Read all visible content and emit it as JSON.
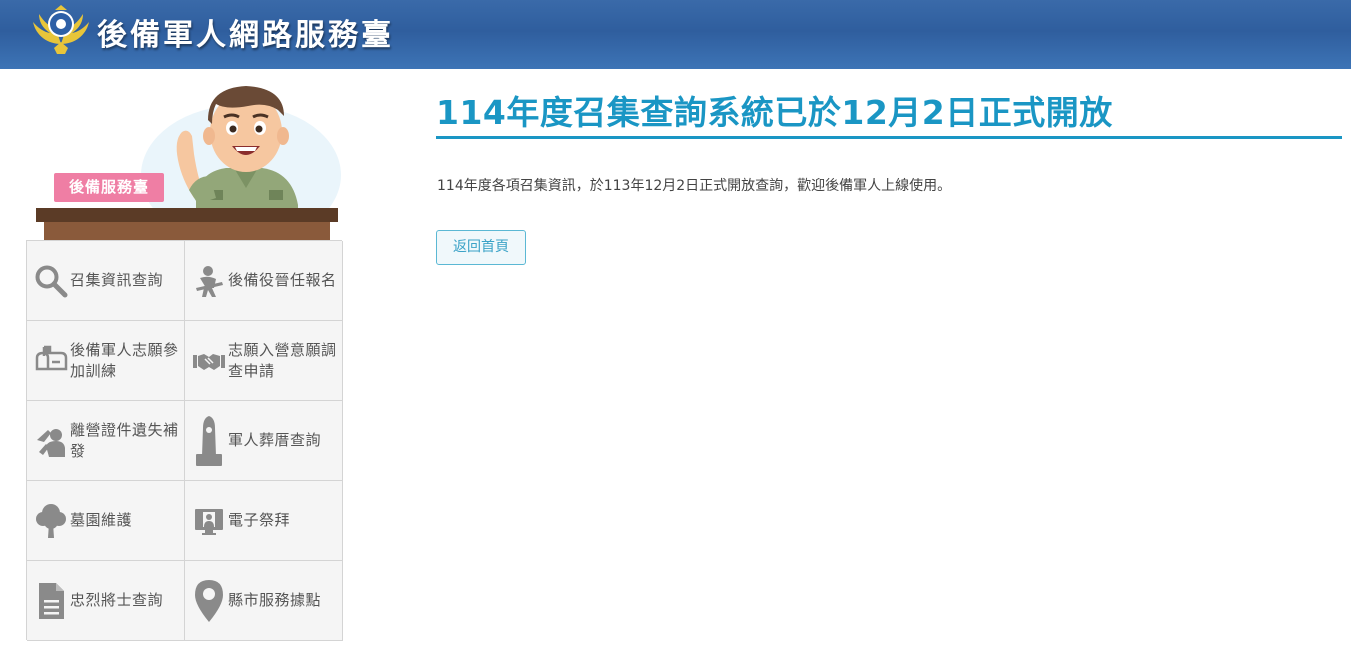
{
  "header": {
    "site_title": "後備軍人網路服務臺"
  },
  "banner": {
    "label": "後備服務臺"
  },
  "menu": {
    "items": [
      {
        "label": "召集資訊查詢",
        "icon": "search-icon"
      },
      {
        "label": "後備役晉任報名",
        "icon": "soldier-icon"
      },
      {
        "label": "後備軍人志願參加訓練",
        "icon": "mailbox-icon"
      },
      {
        "label": "志願入營意願調查申請",
        "icon": "handshake-icon"
      },
      {
        "label": "離營證件遺失補發",
        "icon": "salute-icon"
      },
      {
        "label": "軍人葬厝查詢",
        "icon": "memorial-icon"
      },
      {
        "label": "墓園維護",
        "icon": "tree-icon"
      },
      {
        "label": "電子祭拜",
        "icon": "portrait-monitor-icon"
      },
      {
        "label": "忠烈將士查詢",
        "icon": "document-icon"
      },
      {
        "label": "縣市服務據點",
        "icon": "map-pin-icon"
      }
    ]
  },
  "main": {
    "title": "114年度召集查詢系統已於12月2日正式開放",
    "body": "114年度各項召集資訊，於113年12月2日正式開放查詢，歡迎後備軍人上線使用。",
    "back_button_label": "返回首頁"
  },
  "colors": {
    "header_blue": "#2f5e9e",
    "accent_teal": "#1a96c4",
    "banner_pink": "#ef7ea4",
    "icon_gray": "#8a8a8a"
  }
}
